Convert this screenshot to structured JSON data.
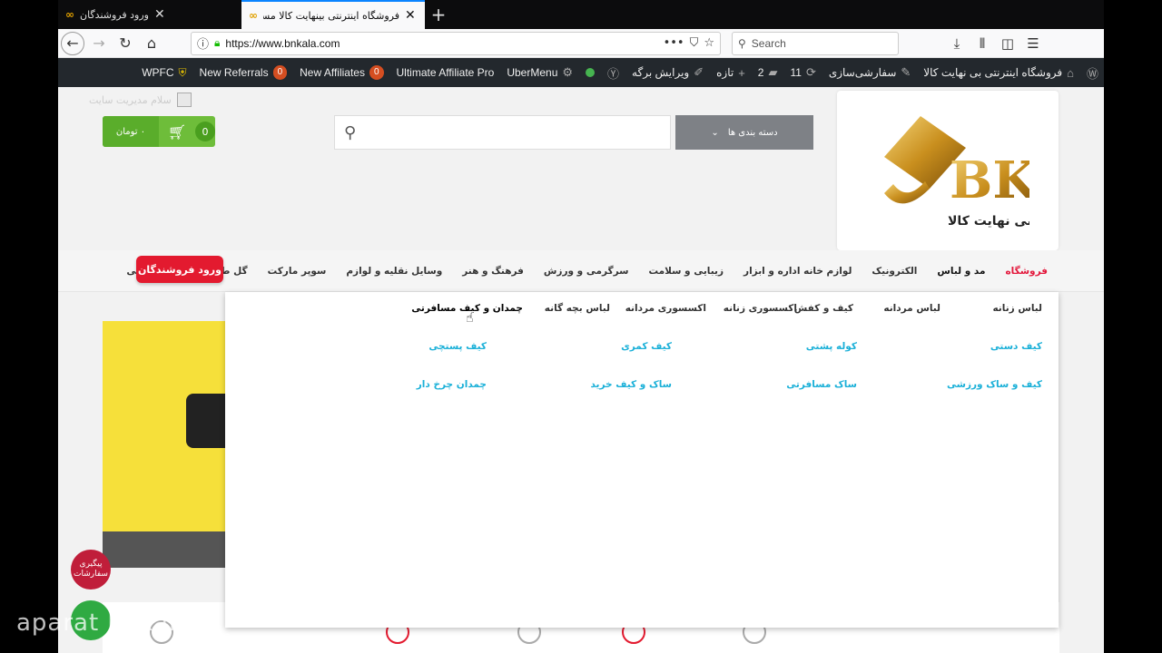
{
  "browser": {
    "tabs": [
      {
        "title": "ورود فروشندگان",
        "active": false
      },
      {
        "title": "فروشگاه اینترنتی بینهایت کالا مستقیم از",
        "active": true
      }
    ],
    "url": "https://www.bnkala.com",
    "search_placeholder": "Search"
  },
  "adminbar": {
    "site_name": "فروشگاه اینترنتی بی نهایت کالا",
    "customize": "سفارشی‌سازی",
    "updates_count": "11",
    "comments_count": "2",
    "new_label": "تازه",
    "edit_page": "ویرایش برگه",
    "ubermenu": "UberMenu",
    "uap": "Ultimate Affiliate Pro",
    "new_affiliates": "New Affiliates",
    "new_affiliates_count": "0",
    "new_referrals": "New Referrals",
    "new_referrals_count": "0",
    "wpfc": "WPFC"
  },
  "header": {
    "user_greeting": "سلام مدیریت سایت",
    "cart_count": "0",
    "cart_price": "۰ تومان",
    "categories_label": "دسته بندی ها",
    "logo_text": "بی نهایت کالا"
  },
  "mainmenu": {
    "items": [
      "فروشگاه",
      "مد و لباس",
      "الکترونیک",
      "لوازم خانه اداره و ابزار",
      "زیبایی و سلامت",
      "سرگرمی و ورزش",
      "فرهنگ و هنر",
      "وسایل نقلیه و لوازم",
      "سوپر مارکت",
      "گل طبیعی و ابزار باغبانی"
    ],
    "seller_button": "ورود فروشندگان"
  },
  "dropdown": {
    "headings": [
      "لباس زنانه",
      "لباس مردانه",
      "کیف و کفش",
      "اکسسوری زنانه",
      "اکسسوری مردانه",
      "لباس بچه گانه",
      "چمدان و کیف مسافرتی"
    ],
    "sub_row1": [
      "کیف دستی",
      "کوله پشتی",
      "کیف کمری",
      "کیف پستچی"
    ],
    "sub_row2": [
      "کیف و ساک ورزشی",
      "ساک مسافرتی",
      "ساک و کیف خرید",
      "چمدان چرخ دار"
    ]
  },
  "floating": {
    "track_orders": "پیگیری سفارشات"
  },
  "watermark": "aparat bnkala",
  "colors": {
    "accent_red": "#e31a2f",
    "cart_green": "#6ebd3a",
    "link_cyan": "#1ab0d8",
    "adminbar_bg": "#23282d"
  }
}
